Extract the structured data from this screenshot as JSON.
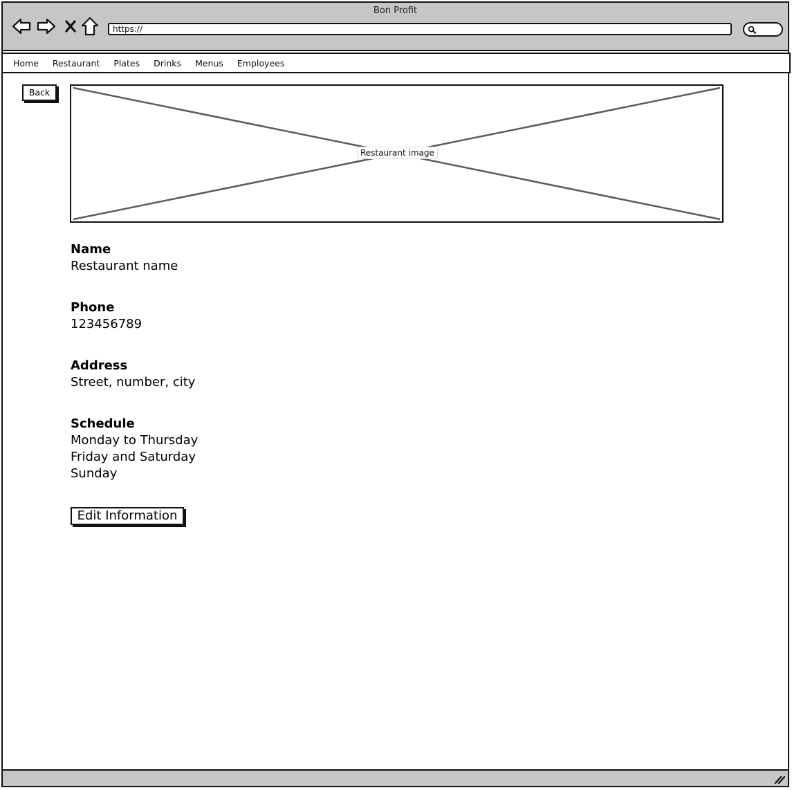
{
  "window": {
    "title": "Bon Profit"
  },
  "toolbar": {
    "url": "https://"
  },
  "menu": {
    "items": [
      "Home",
      "Restaurant",
      "Plates",
      "Drinks",
      "Menus",
      "Employees"
    ]
  },
  "page": {
    "back_label": "Back",
    "image_label": "Restaurant image",
    "name_label": "Name",
    "name_value": "Restaurant name",
    "phone_label": "Phone",
    "phone_value": "123456789",
    "address_label": "Address",
    "address_value": "Street, number, city",
    "schedule_label": "Schedule",
    "schedule_lines": [
      "Monday to Thursday",
      "Friday and Saturday",
      "Sunday"
    ],
    "edit_label": "Edit Information"
  },
  "icons": {
    "back": "back-arrow-icon",
    "forward": "forward-arrow-icon",
    "stop": "close-icon",
    "home": "home-icon",
    "search": "search-icon",
    "resize": "resize-grip-icon"
  },
  "colors": {
    "chrome": "#c6c6c6",
    "border": "#111111",
    "placeholder_lines": "#5a5a5a"
  }
}
